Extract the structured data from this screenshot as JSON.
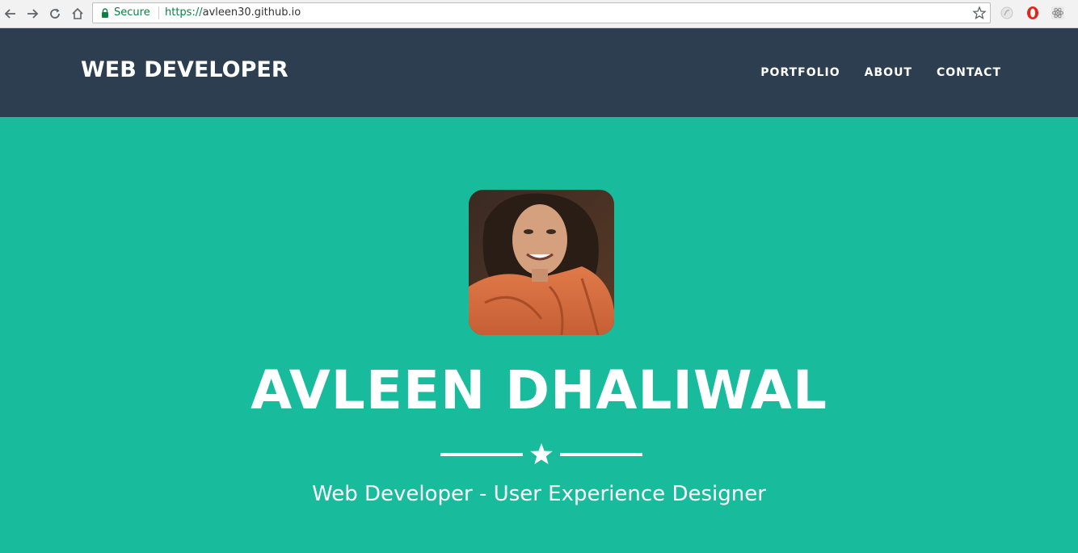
{
  "browser": {
    "secure_label": "Secure",
    "url_scheme": "https://",
    "url_host": "avleen30.github.io"
  },
  "navbar": {
    "brand": "WEB DEVELOPER",
    "links": [
      "PORTFOLIO",
      "ABOUT",
      "CONTACT"
    ],
    "background": "#2c3e50"
  },
  "hero": {
    "name": "AVLEEN DHALIWAL",
    "tagline": "Web Developer - User Experience Designer",
    "divider_icon": "star-icon",
    "background": "#18bc9c"
  },
  "colors": {
    "accent": "#18bc9c",
    "primary": "#2c3e50",
    "secure_green": "#0b8043"
  }
}
